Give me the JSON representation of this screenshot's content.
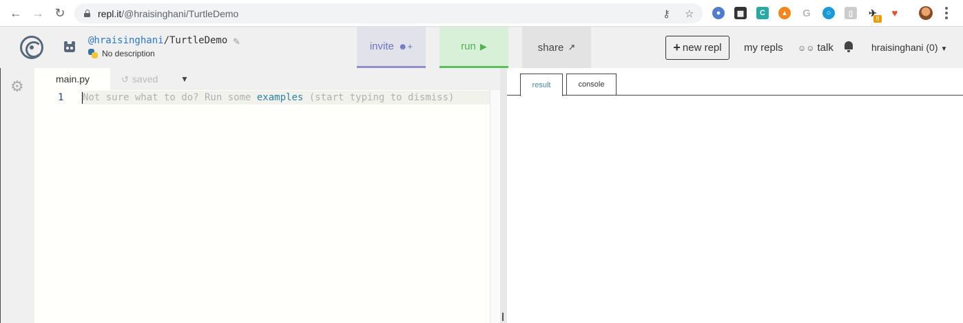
{
  "browser": {
    "url_host": "repl.it",
    "url_path": "/@hraisinghani/TurtleDemo",
    "extension_badge": "8",
    "icons": [
      "back-icon",
      "forward-icon",
      "reload-icon",
      "lock-icon",
      "key-icon",
      "star-icon"
    ]
  },
  "header": {
    "owner": "@hraisinghani",
    "repl_name": "/TurtleDemo",
    "description": "No description",
    "invite_label": "invite",
    "run_label": "run",
    "share_label": "share",
    "new_repl_label": "new repl",
    "my_repls_label": "my repls",
    "talk_label": "talk",
    "account_label": "hraisinghani (0)",
    "colors": {
      "invite": "#6b73c6",
      "run": "#52b152",
      "link": "#2a78d6"
    }
  },
  "editor": {
    "file_name": "main.py",
    "status": "saved",
    "line_number": "1",
    "hint_before": "Not sure what to do? Run some ",
    "hint_link": "examples",
    "hint_after": " (start typing to dismiss)"
  },
  "output": {
    "tabs": [
      {
        "label": "result",
        "active": true
      },
      {
        "label": "console",
        "active": false
      }
    ]
  }
}
